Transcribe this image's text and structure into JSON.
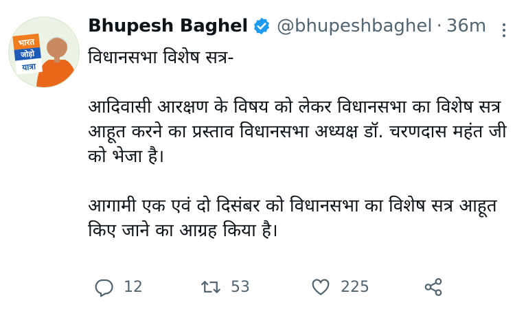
{
  "tweet": {
    "author_name": "Bhupesh Baghel",
    "handle": "@bhupeshbaghel",
    "separator": "·",
    "time": "36m",
    "avatar_badge_text": "भारत जोड़ो यात्रा",
    "body": "विधानसभा विशेष सत्र-\n\nआदिवासी आरक्षण के विषय को लेकर विधानसभा का विशेष सत्र आहूत करने का प्रस्ताव विधानसभा अध्यक्ष डॉ. चरणदास महंत जी को भेजा है।\n\nआगामी एक एवं दो दिसंबर को विधानसभा का विशेष सत्र आहूत किए जाने का आग्रह किया है।",
    "replies": "12",
    "retweets": "53",
    "likes": "225"
  },
  "icons": {
    "verified": "verified-badge-icon",
    "more": "more-options-icon",
    "reply": "reply-icon",
    "retweet": "retweet-icon",
    "like": "heart-icon",
    "share": "share-icon"
  },
  "colors": {
    "verified": "#1d9bf0",
    "text": "#0f1419",
    "secondary": "#536471",
    "badge_orange": "#f07c1e",
    "badge_blue": "#1e5bb8"
  }
}
